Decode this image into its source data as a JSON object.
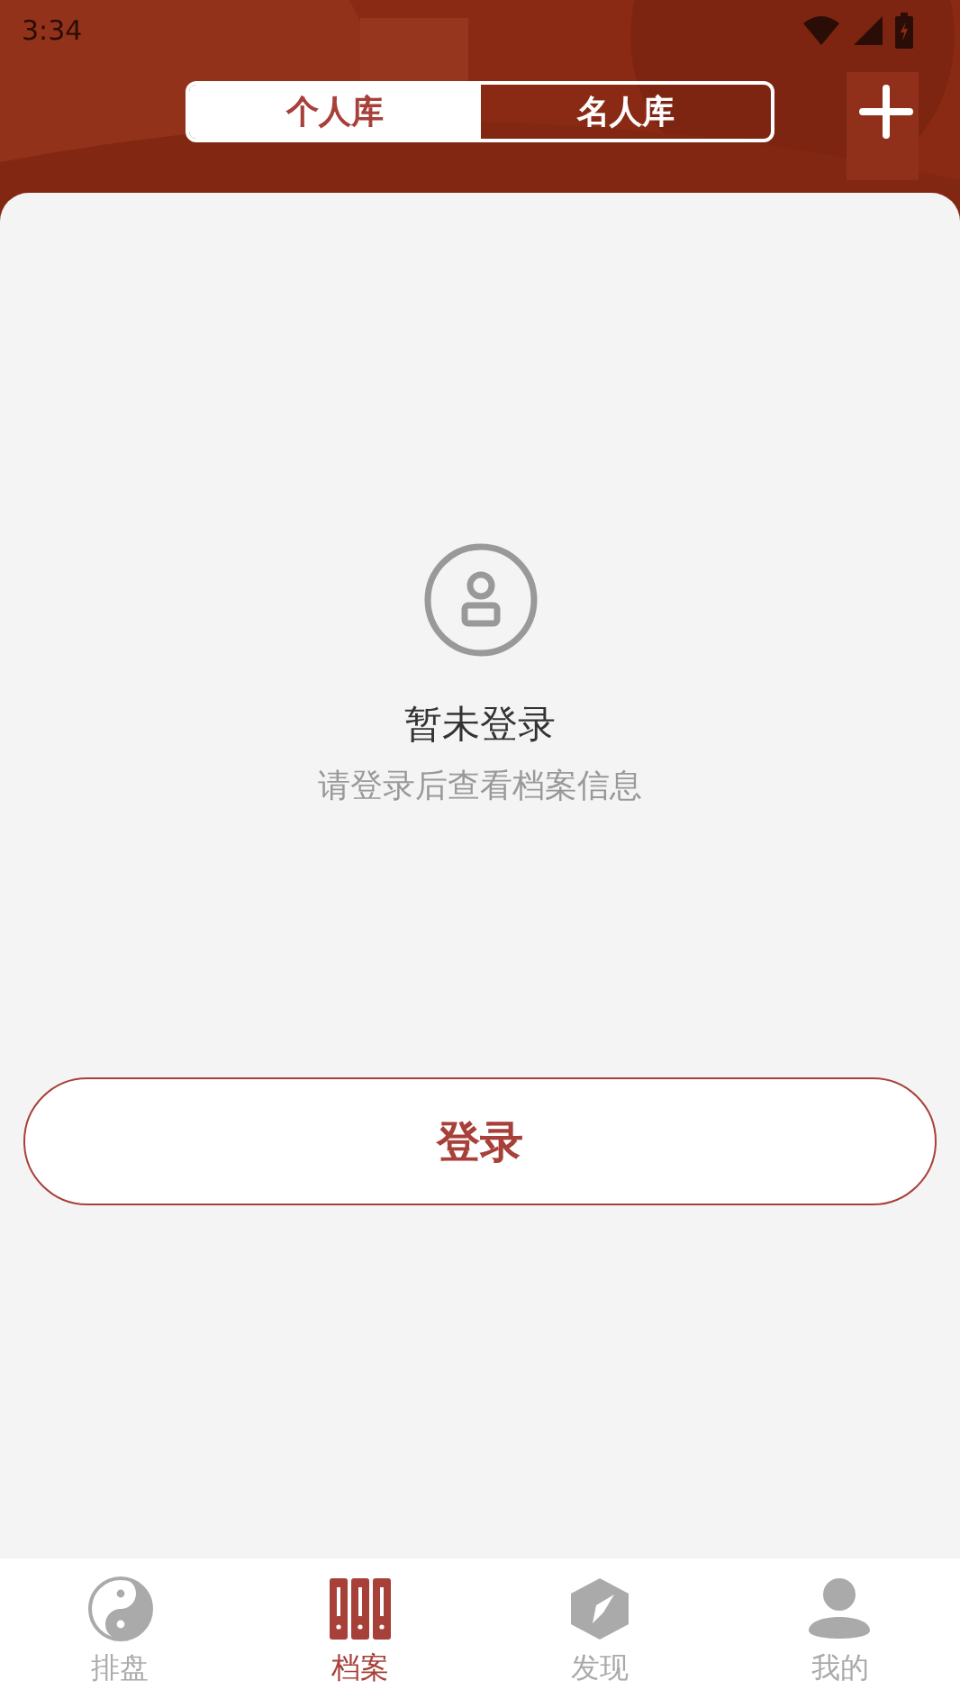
{
  "status_bar": {
    "time": "3:34"
  },
  "tabs": [
    {
      "label": "个人库",
      "selected": true
    },
    {
      "label": "名人库",
      "selected": false
    }
  ],
  "empty_state": {
    "title": "暂未登录",
    "message": "请登录后查看档案信息"
  },
  "login_button": "登录",
  "bottom_nav": [
    {
      "kind": "taiji",
      "label": "排盘",
      "selected": false
    },
    {
      "kind": "files",
      "label": "档案",
      "selected": true
    },
    {
      "kind": "compass",
      "label": "发现",
      "selected": false
    },
    {
      "kind": "person",
      "label": "我的",
      "selected": false
    }
  ]
}
